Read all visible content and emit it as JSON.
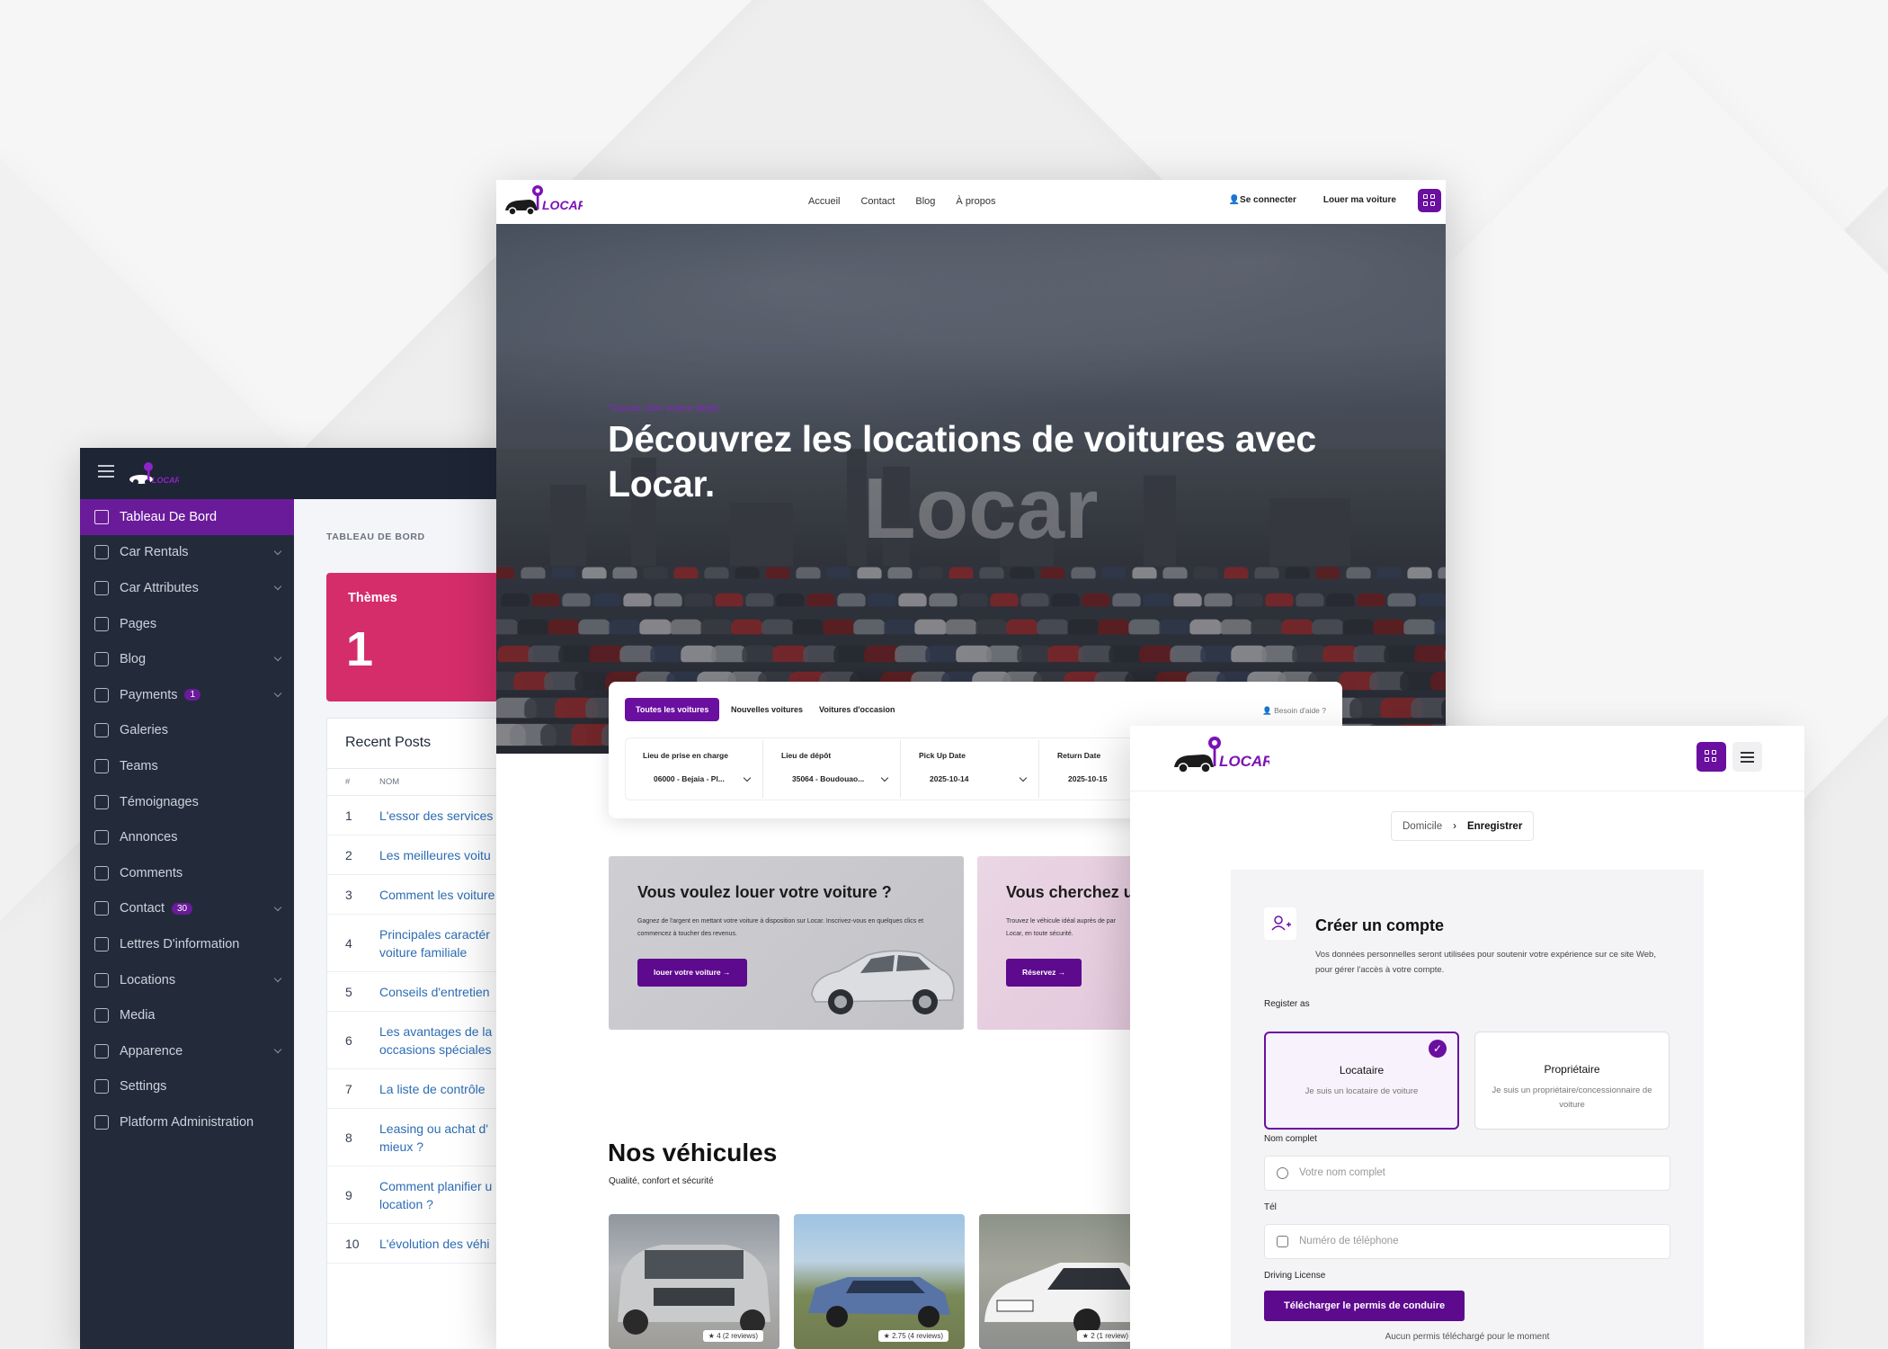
{
  "admin": {
    "crumb": "TABLEAU DE BORD",
    "sidebar": [
      {
        "label": "Tableau De Bord",
        "active": true,
        "chevron": false,
        "badge": ""
      },
      {
        "label": "Car Rentals",
        "chevron": true,
        "badge": ""
      },
      {
        "label": "Car Attributes",
        "chevron": true,
        "badge": ""
      },
      {
        "label": "Pages",
        "chevron": false,
        "badge": ""
      },
      {
        "label": "Blog",
        "chevron": true,
        "badge": ""
      },
      {
        "label": "Payments",
        "chevron": true,
        "badge": "1"
      },
      {
        "label": "Galeries",
        "chevron": false,
        "badge": ""
      },
      {
        "label": "Teams",
        "chevron": false,
        "badge": ""
      },
      {
        "label": "Témoignages",
        "chevron": false,
        "badge": ""
      },
      {
        "label": "Annonces",
        "chevron": false,
        "badge": ""
      },
      {
        "label": "Comments",
        "chevron": false,
        "badge": ""
      },
      {
        "label": "Contact",
        "chevron": true,
        "badge": "30"
      },
      {
        "label": "Lettres D'information",
        "chevron": false,
        "badge": ""
      },
      {
        "label": "Locations",
        "chevron": true,
        "badge": ""
      },
      {
        "label": "Media",
        "chevron": false,
        "badge": ""
      },
      {
        "label": "Apparence",
        "chevron": true,
        "badge": ""
      },
      {
        "label": "Settings",
        "chevron": false,
        "badge": ""
      },
      {
        "label": "Platform Administration",
        "chevron": false,
        "badge": ""
      }
    ],
    "theme_card": {
      "title": "Thèmes",
      "value": "1"
    },
    "recent_posts": {
      "title": "Recent Posts",
      "col_num": "#",
      "col_name": "NOM",
      "rows": [
        {
          "n": "1",
          "lines": [
            "L'essor des services"
          ]
        },
        {
          "n": "2",
          "lines": [
            "Les meilleures voitu"
          ]
        },
        {
          "n": "3",
          "lines": [
            "Comment les voiture"
          ]
        },
        {
          "n": "4",
          "lines": [
            "Principales caractér",
            "voiture familiale"
          ]
        },
        {
          "n": "5",
          "lines": [
            "Conseils d'entretien"
          ]
        },
        {
          "n": "6",
          "lines": [
            "Les avantages de la",
            "occasions spéciales"
          ]
        },
        {
          "n": "7",
          "lines": [
            "La liste de contrôle"
          ]
        },
        {
          "n": "8",
          "lines": [
            "Leasing ou achat d'",
            "mieux ?"
          ]
        },
        {
          "n": "9",
          "lines": [
            "Comment planifier u",
            "location ?"
          ]
        },
        {
          "n": "10",
          "lines": [
            "L'évolution des véhi"
          ]
        }
      ]
    }
  },
  "site": {
    "logo": "LOCAR",
    "nav": [
      "Accueil",
      "Contact",
      "Blog",
      "À propos"
    ],
    "login": "Se connecter",
    "rent_car": "Louer ma voiture",
    "hero": {
      "kicker": "Trouvez votre voiture idéale",
      "title": "Découvrez les locations de voitures avec Locar.",
      "watermark": "Locar"
    },
    "search": {
      "tabs": [
        "Toutes les voitures",
        "Nouvelles voitures",
        "Voitures d'occasion"
      ],
      "help": "Besoin d'aide ?",
      "fields": [
        {
          "label": "Lieu de prise en charge",
          "value": "06000 - Bejaia - Pl..."
        },
        {
          "label": "Lieu de dépôt",
          "value": "35064 - Boudouao..."
        },
        {
          "label": "Pick Up Date",
          "value": "2025-10-14"
        },
        {
          "label": "Return Date",
          "value": "2025-10-15"
        }
      ]
    },
    "promo1": {
      "title": "Vous voulez louer votre voiture ?",
      "text": "Gagnez de l'argent en mettant votre voiture à disposition sur Locar. Inscrivez-vous en quelques clics et commencez à toucher des revenus.",
      "button": "louer votre voiture"
    },
    "promo2": {
      "title": "Vous cherchez un",
      "text": "Trouvez le véhicule idéal auprès de par Locar, en toute sécurité.",
      "button": "Réservez"
    },
    "vehicles": {
      "title": "Nos véhicules",
      "subtitle": "Qualité, confort et sécurité",
      "cards": [
        {
          "rating": "4 (2 reviews)"
        },
        {
          "rating": "2.75 (4 reviews)"
        },
        {
          "rating": "2 (1 review)"
        }
      ]
    }
  },
  "register": {
    "breadcrumb": {
      "home": "Domicile",
      "current": "Enregistrer"
    },
    "title": "Créer un compte",
    "description": "Vos données personnelles seront utilisées pour soutenir votre expérience sur ce site Web, pour gérer l'accès à votre compte.",
    "register_as": "Register as",
    "options": [
      {
        "title": "Locataire",
        "sub": "Je suis un locataire de voiture",
        "selected": true
      },
      {
        "title": "Propriétaire",
        "sub": "Je suis un propriétaire/concessionnaire de voiture",
        "selected": false
      }
    ],
    "name_label": "Nom complet",
    "name_placeholder": "Votre nom complet",
    "phone_label": "Tél",
    "phone_placeholder": "Numéro de téléphone",
    "license_label": "Driving License",
    "upload_button": "Télécharger le permis de conduire",
    "no_license": "Aucun permis téléchargé pour le moment"
  },
  "colors": {
    "brand": "#6a0fa0",
    "theme_card": "#d52d6a",
    "sidebar": "#232b3b"
  }
}
